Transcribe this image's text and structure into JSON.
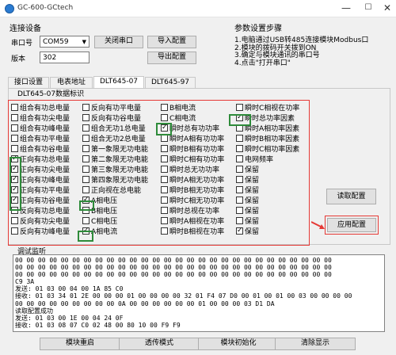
{
  "window": {
    "title": "GC-600-GCtech",
    "min": "—",
    "max": "☐",
    "close": "✕"
  },
  "connect": {
    "heading": "连接设备",
    "port_label": "串口号",
    "port_value": "COM59",
    "version_label": "版本",
    "version_value": "302",
    "close_port": "关闭串口",
    "import_config": "导入配置",
    "export_config": "导出配置"
  },
  "params": {
    "heading": "参数设置步骤",
    "steps": [
      "1.电脑通过USB转485连接模块Modbus口",
      "2.模块的拨码开关拨到ON",
      "3.确定与模块通讯的串口号",
      "4.点击\"打开串口\""
    ]
  },
  "tabs": [
    "接口设置",
    "电表地址",
    "DLT645-07",
    "DLT645-97"
  ],
  "active_tab": "DLT645-07",
  "group_title": "DLT645-07数据标识",
  "checkboxes": {
    "c1": [
      {
        "label": "组合有功总电量",
        "checked": false
      },
      {
        "label": "组合有功尖电量",
        "checked": false
      },
      {
        "label": "组合有功峰电量",
        "checked": false
      },
      {
        "label": "组合有功平电量",
        "checked": false
      },
      {
        "label": "组合有功谷电量",
        "checked": false
      },
      {
        "label": "正向有功总电量",
        "checked": true
      },
      {
        "label": "正向有功尖电量",
        "checked": true
      },
      {
        "label": "正向有功峰电量",
        "checked": true
      },
      {
        "label": "正向有功平电量",
        "checked": true
      },
      {
        "label": "正向有功谷电量",
        "checked": true
      },
      {
        "label": "反向有功总电量",
        "checked": false
      },
      {
        "label": "反向有功尖电量",
        "checked": false
      },
      {
        "label": "反向有功峰电量",
        "checked": false
      }
    ],
    "c2": [
      {
        "label": "反向有功平电量",
        "checked": false
      },
      {
        "label": "反向有功谷电量",
        "checked": false
      },
      {
        "label": "组合无功1总电量",
        "checked": false
      },
      {
        "label": "组合无功2总电量",
        "checked": false
      },
      {
        "label": "第一象限无功电能",
        "checked": false
      },
      {
        "label": "第二象限无功电能",
        "checked": false
      },
      {
        "label": "第三象限无功电能",
        "checked": false
      },
      {
        "label": "第四象限无功电能",
        "checked": false
      },
      {
        "label": "正向视在总电能",
        "checked": false
      },
      {
        "label": "A相电压",
        "checked": true
      },
      {
        "label": "B相电压",
        "checked": false
      },
      {
        "label": "C相电压",
        "checked": false
      },
      {
        "label": "A相电流",
        "checked": true
      }
    ],
    "c3": [
      {
        "label": "B相电流",
        "checked": false
      },
      {
        "label": "C相电流",
        "checked": false
      },
      {
        "label": "瞬时总有功功率",
        "checked": true
      },
      {
        "label": "瞬时A相有功功率",
        "checked": false
      },
      {
        "label": "瞬时B相有功功率",
        "checked": false
      },
      {
        "label": "瞬时C相有功功率",
        "checked": false
      },
      {
        "label": "瞬时总无功功率",
        "checked": false
      },
      {
        "label": "瞬时A相无功功率",
        "checked": false
      },
      {
        "label": "瞬时B相无功功率",
        "checked": false
      },
      {
        "label": "瞬时C相无功功率",
        "checked": false
      },
      {
        "label": "瞬时总视在功率",
        "checked": false
      },
      {
        "label": "瞬时A相视在功率",
        "checked": false
      },
      {
        "label": "瞬时B相视在功率",
        "checked": false
      }
    ],
    "c4": [
      {
        "label": "瞬时C相视在功率",
        "checked": false
      },
      {
        "label": "瞬时总功率因素",
        "checked": true
      },
      {
        "label": "瞬时A相功率因素",
        "checked": false
      },
      {
        "label": "瞬时B相功率因素",
        "checked": false
      },
      {
        "label": "瞬时C相功率因素",
        "checked": false
      },
      {
        "label": "电网频率",
        "checked": false
      },
      {
        "label": "保留",
        "checked": false
      },
      {
        "label": "保留",
        "checked": false
      },
      {
        "label": "保留",
        "checked": false
      },
      {
        "label": "保留",
        "checked": false
      },
      {
        "label": "保留",
        "checked": false
      },
      {
        "label": "保留",
        "checked": false
      },
      {
        "label": "保留",
        "checked": true
      }
    ]
  },
  "read_config": "读取配置",
  "apply_config": "应用配置",
  "monitor": {
    "title": "调试监听",
    "lines": [
      "00 00 00 00 00 00 00 00 00 00 00 00 00 00 00 00 00 00 00 00 00 00 00 00 00 00 00 00",
      "00 00 00 00 00 00 00 00 00 00 00 00 00 00 00 00 00 00 00 00 00 00 00 00 00 00 00 00",
      "00 00 00 00 00 00 00 00 00 00 00 00 00 00 00 00 00 00 00 00 00 00 00 00 00 00 00 00",
      "C9 3A",
      "发送: 01 03 00 04 00 1A 85 C0",
      "接收: 01 03 34 01 2E 00 00 00 01 00 00 00 00 32 01 F4 07 D0 00 01 00 01 00 03 00 00 00 00",
      "00 00 00 00 00 00 00 00 00 0A 00 00 00 00 00 00 01 00 00 00 03 D1 DA",
      "读取配置成功",
      "发送: 01 03 00 1E 00 04 24 0F",
      "接收: 01 03 08 07 C0 02 48 00 80 10 00 F9 F9"
    ]
  },
  "bottom": {
    "restart": "模块重启",
    "transparent": "透传模式",
    "init": "模块初始化",
    "clear": "清除显示"
  },
  "colors": {
    "highlight_red": "#e53935",
    "highlight_green": "#2e8b3a"
  }
}
